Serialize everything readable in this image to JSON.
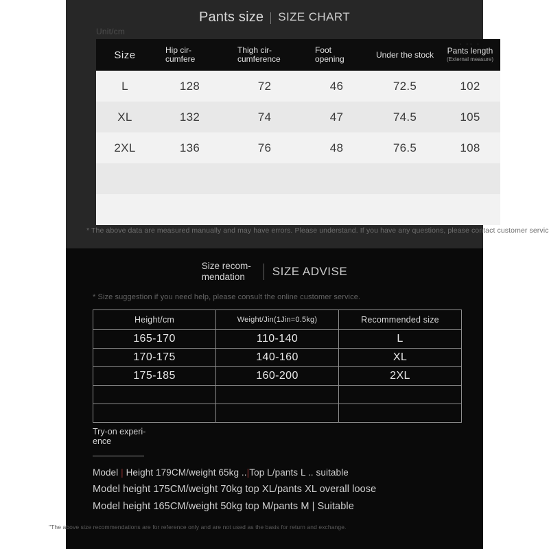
{
  "chart_section": {
    "title_cn": "Pants size",
    "title_en": "SIZE CHART",
    "unit_label": "Unit/cm",
    "note": "* The above data are measured manually and may have errors. Please understand. If you have any questions, please contact customer service.",
    "table": {
      "headers": [
        {
          "label": "Size",
          "sub": ""
        },
        {
          "label": "Hip cir-\ncumfere",
          "sub": ""
        },
        {
          "label": "Thigh cir-\ncumference",
          "sub": ""
        },
        {
          "label": "Foot\nopening",
          "sub": ""
        },
        {
          "label": "Under the stock",
          "sub": ""
        },
        {
          "label": "Pants length",
          "sub": "(External measure)"
        }
      ],
      "header_plain": {
        "size": "Size",
        "hip_l1": "Hip cir-",
        "hip_l2": "cumfere",
        "thigh_l1": "Thigh cir-",
        "thigh_l2": "cumference",
        "foot_l1": "Foot",
        "foot_l2": "opening",
        "under_stock": "Under the stock",
        "pants_length": "Pants length",
        "pants_length_sub": "(External measure)",
        "dots": "· ·· ·"
      },
      "rows": [
        {
          "size": "L",
          "hip": "128",
          "thigh": "72",
          "foot": "46",
          "under": "72.5",
          "length": "102"
        },
        {
          "size": "XL",
          "hip": "132",
          "thigh": "74",
          "foot": "47",
          "under": "74.5",
          "length": "105"
        },
        {
          "size": "2XL",
          "hip": "136",
          "thigh": "76",
          "foot": "48",
          "under": "76.5",
          "length": "108"
        },
        {
          "size": "",
          "hip": "",
          "thigh": "",
          "foot": "",
          "under": "",
          "length": ""
        },
        {
          "size": "",
          "hip": "",
          "thigh": "",
          "foot": "",
          "under": "",
          "length": ""
        }
      ]
    }
  },
  "advise_section": {
    "title_cn_l1": "Size recom-",
    "title_cn_l2": "mendation",
    "title_en": "SIZE ADVISE",
    "note": "* Size suggestion if you need help, please consult the online customer service.",
    "table": {
      "headers": {
        "height": "Height/cm",
        "weight": "Weight/Jin(1Jin=0.5kg)",
        "recommended": "Recommended size"
      },
      "rows": [
        {
          "height": "165-170",
          "weight": "110-140",
          "size": "L"
        },
        {
          "height": "170-175",
          "weight": "140-160",
          "size": "XL"
        },
        {
          "height": "175-185",
          "weight": "160-200",
          "size": "2XL"
        },
        {
          "height": "",
          "weight": "",
          "size": ""
        },
        {
          "height": "",
          "weight": "",
          "size": ""
        }
      ]
    },
    "tryon": {
      "title_l1": "Try-on experi-",
      "title_l2": "ence",
      "line1_a": "Model ",
      "line1_sep1": "|",
      "line1_b": " Height 179CM/weight 65kg ..",
      "line1_sep2": "|",
      "line1_c": "Top L/pants L .. suitable",
      "line2": "Model height 175CM/weight 70kg top XL/pants XL overall loose",
      "line3_a": "Model height 165CM/weight 50kg top M/pants M ",
      "line3_sep": "|",
      "line3_b": " Suitable"
    },
    "bottom_note": "\"The above size recommendations are for reference only and are not used as the basis for return and exchange."
  },
  "colors": {
    "chart_panel_bg": "#272727",
    "advise_panel_bg": "#0a0a0a",
    "table_header_bg": "#0d0d0d",
    "row_light": "#f2f2f2",
    "row_dark": "#e8e8e8",
    "accent_red": "#8c2f2f",
    "border_grey": "#8e8e8e"
  }
}
